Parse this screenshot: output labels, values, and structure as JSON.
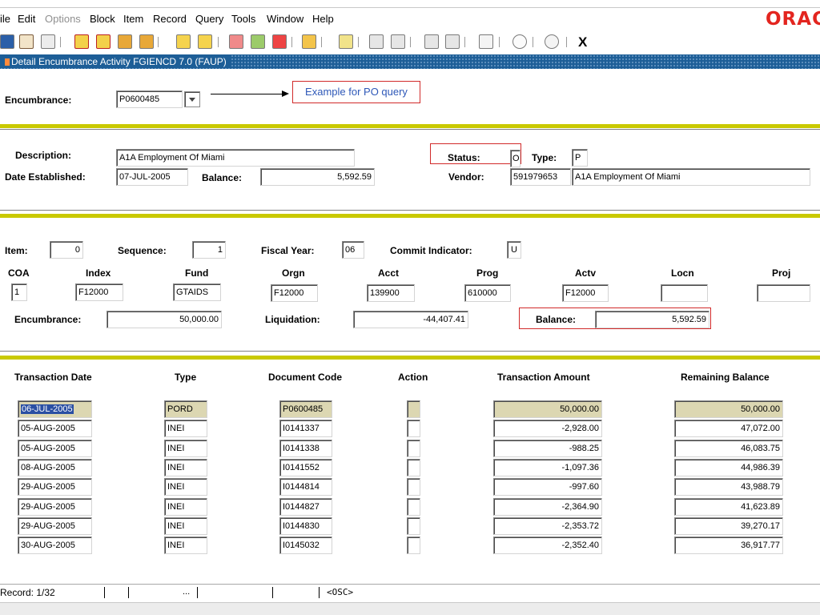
{
  "menu": {
    "items": [
      {
        "label": "ile",
        "key": "file"
      },
      {
        "label": "Edit",
        "key": "edit"
      },
      {
        "label": "Options",
        "key": "options",
        "disabled": true
      },
      {
        "label": "Block",
        "key": "block"
      },
      {
        "label": "Item",
        "key": "item"
      },
      {
        "label": "Record",
        "key": "record"
      },
      {
        "label": "Query",
        "key": "query"
      },
      {
        "label": "Tools",
        "key": "tools"
      },
      {
        "label": "Window",
        "key": "window"
      },
      {
        "label": "Help",
        "key": "help"
      }
    ],
    "logo_text": "ORAC"
  },
  "toolbar": {
    "exit_label": "X"
  },
  "window": {
    "title": "Detail Encumbrance Activity  FGIENCD  7.0  (FAUP)"
  },
  "key_block": {
    "encumbrance_label": "Encumbrance:",
    "encumbrance_value": "P0600485",
    "annotation": "Example for PO query"
  },
  "header_block": {
    "description_label": "Description:",
    "description_value": "A1A Employment Of Miami",
    "date_label": "Date Established:",
    "date_value": "07-JUL-2005",
    "balance_label": "Balance:",
    "balance_value": "5,592.59",
    "status_label": "Status:",
    "status_value": "O",
    "type_label": "Type:",
    "type_value": "P",
    "vendor_label": "Vendor:",
    "vendor_id": "591979653",
    "vendor_name": "A1A Employment Of Miami"
  },
  "item_block": {
    "item_label": "Item:",
    "item_value": "0",
    "sequence_label": "Sequence:",
    "sequence_value": "1",
    "fiscal_year_label": "Fiscal Year:",
    "fiscal_year_value": "06",
    "commit_label": "Commit Indicator:",
    "commit_value": "U",
    "coa_label": "COA",
    "coa_value": "1",
    "index_label": "Index",
    "index_value": "F12000",
    "fund_label": "Fund",
    "fund_value": "GTAIDS",
    "orgn_label": "Orgn",
    "orgn_value": "F12000",
    "acct_label": "Acct",
    "acct_value": "139900",
    "prog_label": "Prog",
    "prog_value": "610000",
    "actv_label": "Actv",
    "actv_value": "F12000",
    "locn_label": "Locn",
    "locn_value": "",
    "proj_label": "Proj",
    "proj_value": "",
    "encumbrance_label": "Encumbrance:",
    "encumbrance_value": "50,000.00",
    "liquidation_label": "Liquidation:",
    "liquidation_value": "-44,407.41",
    "balance_label": "Balance:",
    "balance_value": "5,592.59"
  },
  "transactions": {
    "headers": {
      "date": "Transaction Date",
      "type": "Type",
      "doc": "Document Code",
      "action": "Action",
      "amount": "Transaction Amount",
      "remaining": "Remaining Balance"
    },
    "rows": [
      {
        "date": "06-JUL-2005",
        "type": "PORD",
        "doc": "P0600485",
        "action": "",
        "amount": "50,000.00",
        "remaining": "50,000.00"
      },
      {
        "date": "05-AUG-2005",
        "type": "INEI",
        "doc": "I0141337",
        "action": "",
        "amount": "-2,928.00",
        "remaining": "47,072.00"
      },
      {
        "date": "05-AUG-2005",
        "type": "INEI",
        "doc": "I0141338",
        "action": "",
        "amount": "-988.25",
        "remaining": "46,083.75"
      },
      {
        "date": "08-AUG-2005",
        "type": "INEI",
        "doc": "I0141552",
        "action": "",
        "amount": "-1,097.36",
        "remaining": "44,986.39"
      },
      {
        "date": "29-AUG-2005",
        "type": "INEI",
        "doc": "I0144814",
        "action": "",
        "amount": "-997.60",
        "remaining": "43,988.79"
      },
      {
        "date": "29-AUG-2005",
        "type": "INEI",
        "doc": "I0144827",
        "action": "",
        "amount": "-2,364.90",
        "remaining": "41,623.89"
      },
      {
        "date": "29-AUG-2005",
        "type": "INEI",
        "doc": "I0144830",
        "action": "",
        "amount": "-2,353.72",
        "remaining": "39,270.17"
      },
      {
        "date": "30-AUG-2005",
        "type": "INEI",
        "doc": "I0145032",
        "action": "",
        "amount": "-2,352.40",
        "remaining": "36,917.77"
      }
    ]
  },
  "status_bar": {
    "record": "Record: 1/32",
    "dots": "...",
    "mode": "<OSC>"
  },
  "colors": {
    "title_bar": "#1d5e97",
    "divider_yellow": "#c9c900",
    "highlight_red": "#d12a2a",
    "annotation_blue": "#2e58b8",
    "current_row": "#dcd7b2"
  }
}
